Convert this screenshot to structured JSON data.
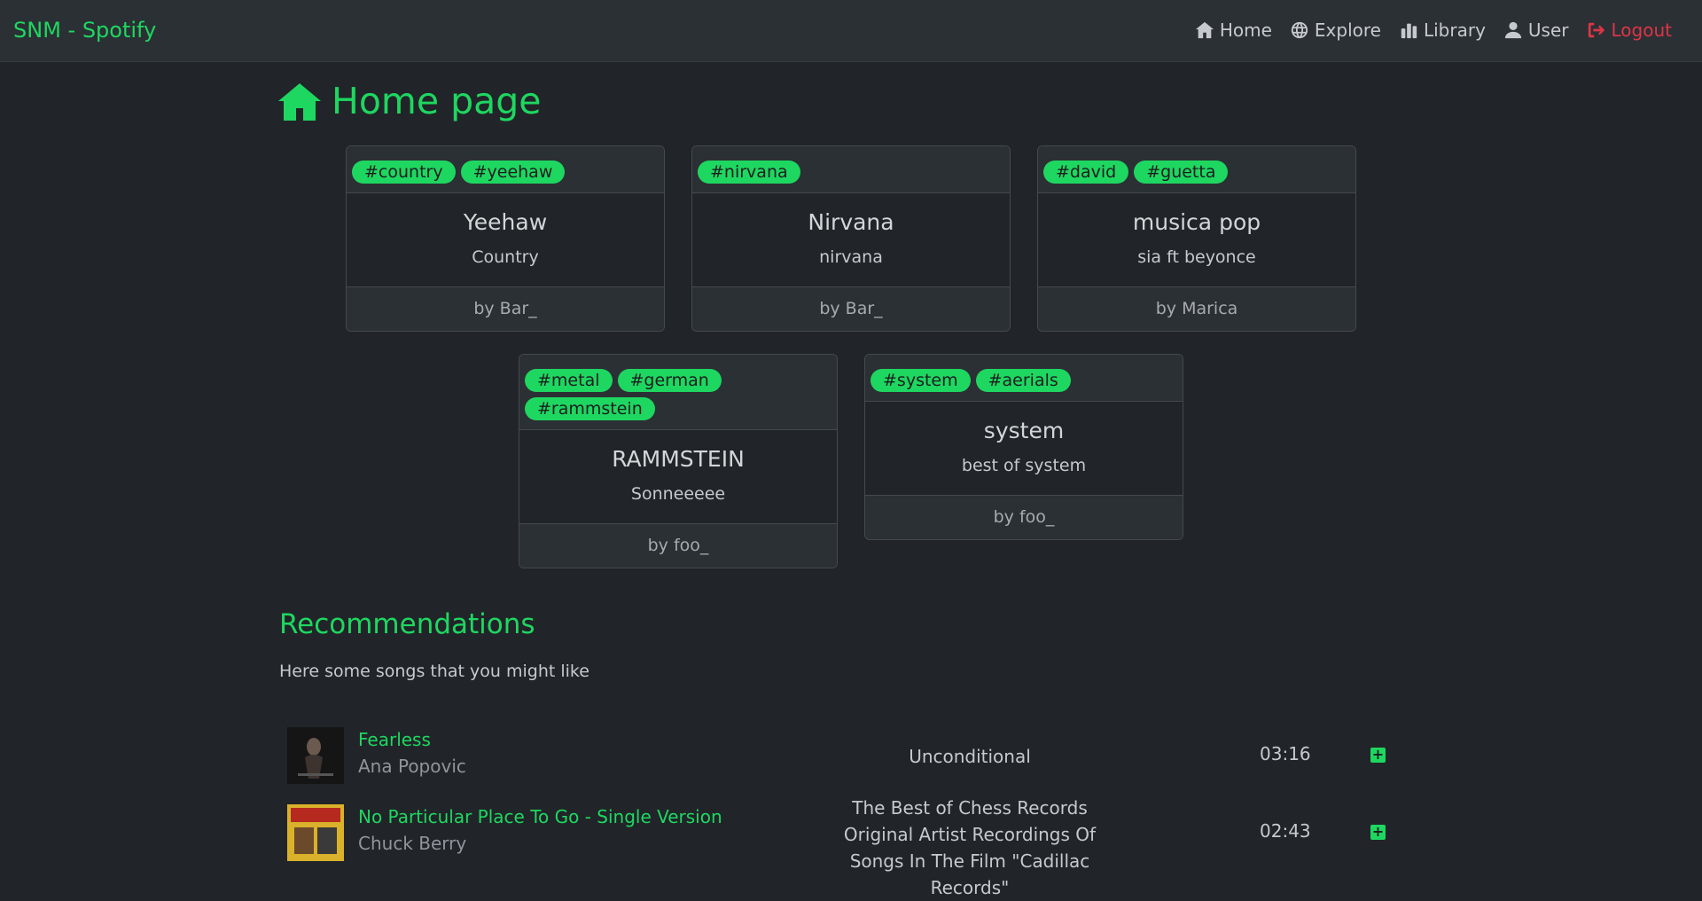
{
  "app": {
    "brand": "SNM - Spotify"
  },
  "nav": {
    "home": "Home",
    "explore": "Explore",
    "library": "Library",
    "user": "User",
    "logout": "Logout"
  },
  "page": {
    "title": "Home page"
  },
  "playlists": [
    {
      "tags": [
        "#country",
        "#yeehaw"
      ],
      "title": "Yeehaw",
      "description": "Country",
      "author": "by Bar_"
    },
    {
      "tags": [
        "#nirvana"
      ],
      "title": "Nirvana",
      "description": "nirvana",
      "author": "by Bar_"
    },
    {
      "tags": [
        "#david",
        "#guetta"
      ],
      "title": "musica pop",
      "description": "sia ft beyonce",
      "author": "by Marica"
    },
    {
      "tags": [
        "#metal",
        "#german",
        "#rammstein"
      ],
      "title": "RAMMSTEIN",
      "description": "Sonneeeee",
      "author": "by foo_"
    },
    {
      "tags": [
        "#system",
        "#aerials"
      ],
      "title": "system",
      "description": "best of system",
      "author": "by foo_"
    }
  ],
  "recommendations": {
    "title": "Recommendations",
    "subtitle": "Here some songs that you might like",
    "songs": [
      {
        "title": "Fearless",
        "artist": "Ana Popovic",
        "album": "Unconditional",
        "duration": "03:16"
      },
      {
        "title": "No Particular Place To Go - Single Version",
        "artist": "Chuck Berry",
        "album": "The Best of Chess Records Original Artist Recordings Of Songs In The Film \"Cadillac Records\"",
        "duration": "02:43"
      }
    ],
    "add_label": "+"
  },
  "colors": {
    "accent": "#1ed760",
    "danger": "#dc3545",
    "background": "#212529",
    "navbar": "#2b3035"
  }
}
